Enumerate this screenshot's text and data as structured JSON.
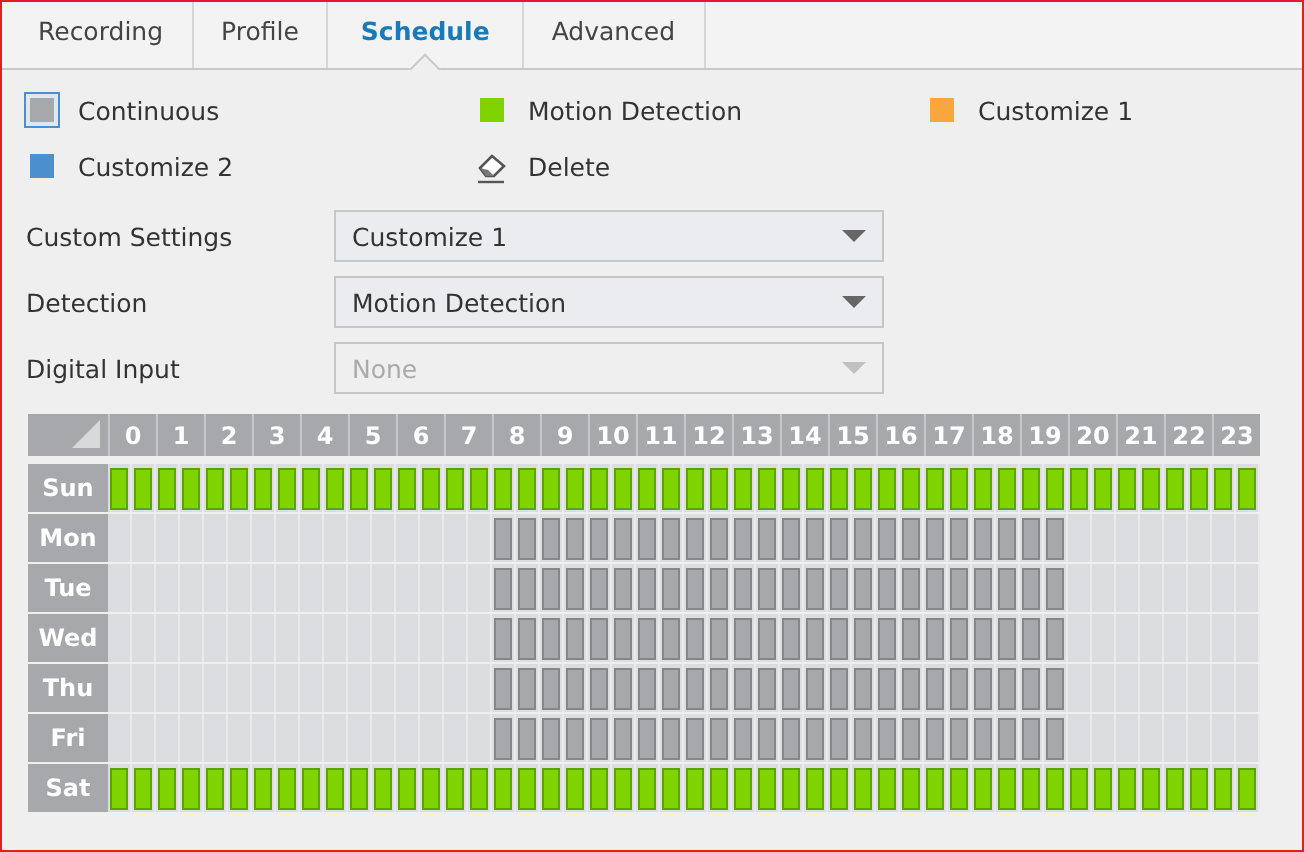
{
  "tabs": [
    {
      "label": "Recording",
      "selected": false
    },
    {
      "label": "Profile",
      "selected": false
    },
    {
      "label": "Schedule",
      "selected": true
    },
    {
      "label": "Advanced",
      "selected": false
    }
  ],
  "legend": [
    {
      "label": "Continuous",
      "kind": "swatch",
      "color": "#a6a8ab",
      "selected": true
    },
    {
      "label": "Motion Detection",
      "kind": "swatch",
      "color": "#7fd400",
      "selected": false
    },
    {
      "label": "Customize 1",
      "kind": "swatch",
      "color": "#f9a63c",
      "selected": false
    },
    {
      "label": "Customize 2",
      "kind": "swatch",
      "color": "#4d8fcc",
      "selected": false
    },
    {
      "label": "Delete",
      "kind": "eraser",
      "selected": false
    }
  ],
  "settings": [
    {
      "label": "Custom Settings",
      "value": "Customize 1",
      "disabled": false
    },
    {
      "label": "Detection",
      "value": "Motion Detection",
      "disabled": false
    },
    {
      "label": "Digital Input",
      "value": "None",
      "disabled": true
    }
  ],
  "schedule": {
    "hours": [
      "0",
      "1",
      "2",
      "3",
      "4",
      "5",
      "6",
      "7",
      "8",
      "9",
      "10",
      "11",
      "12",
      "13",
      "14",
      "15",
      "16",
      "17",
      "18",
      "19",
      "20",
      "21",
      "22",
      "23"
    ],
    "days": [
      {
        "label": "Sun",
        "slots": [
          {
            "kind": "motion"
          },
          {
            "kind": "motion"
          },
          {
            "kind": "motion"
          },
          {
            "kind": "motion"
          },
          {
            "kind": "motion"
          },
          {
            "kind": "motion"
          },
          {
            "kind": "motion"
          },
          {
            "kind": "motion"
          },
          {
            "kind": "motion"
          },
          {
            "kind": "motion"
          },
          {
            "kind": "motion"
          },
          {
            "kind": "motion"
          },
          {
            "kind": "motion"
          },
          {
            "kind": "motion"
          },
          {
            "kind": "motion"
          },
          {
            "kind": "motion"
          },
          {
            "kind": "motion"
          },
          {
            "kind": "motion"
          },
          {
            "kind": "motion"
          },
          {
            "kind": "motion"
          },
          {
            "kind": "motion"
          },
          {
            "kind": "motion"
          },
          {
            "kind": "motion"
          },
          {
            "kind": "motion"
          },
          {
            "kind": "motion"
          },
          {
            "kind": "motion"
          },
          {
            "kind": "motion"
          },
          {
            "kind": "motion"
          },
          {
            "kind": "motion"
          },
          {
            "kind": "motion"
          },
          {
            "kind": "motion"
          },
          {
            "kind": "motion"
          },
          {
            "kind": "motion"
          },
          {
            "kind": "motion"
          },
          {
            "kind": "motion"
          },
          {
            "kind": "motion"
          },
          {
            "kind": "motion"
          },
          {
            "kind": "motion"
          },
          {
            "kind": "motion"
          },
          {
            "kind": "motion"
          },
          {
            "kind": "motion"
          },
          {
            "kind": "motion"
          },
          {
            "kind": "motion"
          },
          {
            "kind": "motion"
          },
          {
            "kind": "motion"
          },
          {
            "kind": "motion"
          },
          {
            "kind": "motion"
          },
          {
            "kind": "motion"
          }
        ]
      },
      {
        "label": "Mon",
        "slots": [
          {
            "kind": "empty"
          },
          {
            "kind": "empty"
          },
          {
            "kind": "empty"
          },
          {
            "kind": "empty"
          },
          {
            "kind": "empty"
          },
          {
            "kind": "empty"
          },
          {
            "kind": "empty"
          },
          {
            "kind": "empty"
          },
          {
            "kind": "empty"
          },
          {
            "kind": "empty"
          },
          {
            "kind": "empty"
          },
          {
            "kind": "empty"
          },
          {
            "kind": "empty"
          },
          {
            "kind": "empty"
          },
          {
            "kind": "empty"
          },
          {
            "kind": "empty"
          },
          {
            "kind": "continuous"
          },
          {
            "kind": "continuous"
          },
          {
            "kind": "continuous"
          },
          {
            "kind": "continuous"
          },
          {
            "kind": "continuous"
          },
          {
            "kind": "continuous"
          },
          {
            "kind": "continuous"
          },
          {
            "kind": "continuous"
          },
          {
            "kind": "continuous"
          },
          {
            "kind": "continuous"
          },
          {
            "kind": "continuous"
          },
          {
            "kind": "continuous"
          },
          {
            "kind": "continuous"
          },
          {
            "kind": "continuous"
          },
          {
            "kind": "continuous"
          },
          {
            "kind": "continuous"
          },
          {
            "kind": "continuous"
          },
          {
            "kind": "continuous"
          },
          {
            "kind": "continuous"
          },
          {
            "kind": "continuous"
          },
          {
            "kind": "continuous"
          },
          {
            "kind": "continuous"
          },
          {
            "kind": "continuous"
          },
          {
            "kind": "continuous"
          },
          {
            "kind": "empty"
          },
          {
            "kind": "empty"
          },
          {
            "kind": "empty"
          },
          {
            "kind": "empty"
          },
          {
            "kind": "empty"
          },
          {
            "kind": "empty"
          },
          {
            "kind": "empty"
          },
          {
            "kind": "empty"
          }
        ]
      },
      {
        "label": "Tue",
        "slots": [
          {
            "kind": "empty"
          },
          {
            "kind": "empty"
          },
          {
            "kind": "empty"
          },
          {
            "kind": "empty"
          },
          {
            "kind": "empty"
          },
          {
            "kind": "empty"
          },
          {
            "kind": "empty"
          },
          {
            "kind": "empty"
          },
          {
            "kind": "empty"
          },
          {
            "kind": "empty"
          },
          {
            "kind": "empty"
          },
          {
            "kind": "empty"
          },
          {
            "kind": "empty"
          },
          {
            "kind": "empty"
          },
          {
            "kind": "empty"
          },
          {
            "kind": "empty"
          },
          {
            "kind": "continuous"
          },
          {
            "kind": "continuous"
          },
          {
            "kind": "continuous"
          },
          {
            "kind": "continuous"
          },
          {
            "kind": "continuous"
          },
          {
            "kind": "continuous"
          },
          {
            "kind": "continuous"
          },
          {
            "kind": "continuous"
          },
          {
            "kind": "continuous"
          },
          {
            "kind": "continuous"
          },
          {
            "kind": "continuous"
          },
          {
            "kind": "continuous"
          },
          {
            "kind": "continuous"
          },
          {
            "kind": "continuous"
          },
          {
            "kind": "continuous"
          },
          {
            "kind": "continuous"
          },
          {
            "kind": "continuous"
          },
          {
            "kind": "continuous"
          },
          {
            "kind": "continuous"
          },
          {
            "kind": "continuous"
          },
          {
            "kind": "continuous"
          },
          {
            "kind": "continuous"
          },
          {
            "kind": "continuous"
          },
          {
            "kind": "continuous"
          },
          {
            "kind": "empty"
          },
          {
            "kind": "empty"
          },
          {
            "kind": "empty"
          },
          {
            "kind": "empty"
          },
          {
            "kind": "empty"
          },
          {
            "kind": "empty"
          },
          {
            "kind": "empty"
          },
          {
            "kind": "empty"
          }
        ]
      },
      {
        "label": "Wed",
        "slots": [
          {
            "kind": "empty"
          },
          {
            "kind": "empty"
          },
          {
            "kind": "empty"
          },
          {
            "kind": "empty"
          },
          {
            "kind": "empty"
          },
          {
            "kind": "empty"
          },
          {
            "kind": "empty"
          },
          {
            "kind": "empty"
          },
          {
            "kind": "empty"
          },
          {
            "kind": "empty"
          },
          {
            "kind": "empty"
          },
          {
            "kind": "empty"
          },
          {
            "kind": "empty"
          },
          {
            "kind": "empty"
          },
          {
            "kind": "empty"
          },
          {
            "kind": "empty"
          },
          {
            "kind": "continuous"
          },
          {
            "kind": "continuous"
          },
          {
            "kind": "continuous"
          },
          {
            "kind": "continuous"
          },
          {
            "kind": "continuous"
          },
          {
            "kind": "continuous"
          },
          {
            "kind": "continuous"
          },
          {
            "kind": "continuous"
          },
          {
            "kind": "continuous"
          },
          {
            "kind": "continuous"
          },
          {
            "kind": "continuous"
          },
          {
            "kind": "continuous"
          },
          {
            "kind": "continuous"
          },
          {
            "kind": "continuous"
          },
          {
            "kind": "continuous"
          },
          {
            "kind": "continuous"
          },
          {
            "kind": "continuous"
          },
          {
            "kind": "continuous"
          },
          {
            "kind": "continuous"
          },
          {
            "kind": "continuous"
          },
          {
            "kind": "continuous"
          },
          {
            "kind": "continuous"
          },
          {
            "kind": "continuous"
          },
          {
            "kind": "continuous"
          },
          {
            "kind": "empty"
          },
          {
            "kind": "empty"
          },
          {
            "kind": "empty"
          },
          {
            "kind": "empty"
          },
          {
            "kind": "empty"
          },
          {
            "kind": "empty"
          },
          {
            "kind": "empty"
          },
          {
            "kind": "empty"
          }
        ]
      },
      {
        "label": "Thu",
        "slots": [
          {
            "kind": "empty"
          },
          {
            "kind": "empty"
          },
          {
            "kind": "empty"
          },
          {
            "kind": "empty"
          },
          {
            "kind": "empty"
          },
          {
            "kind": "empty"
          },
          {
            "kind": "empty"
          },
          {
            "kind": "empty"
          },
          {
            "kind": "empty"
          },
          {
            "kind": "empty"
          },
          {
            "kind": "empty"
          },
          {
            "kind": "empty"
          },
          {
            "kind": "empty"
          },
          {
            "kind": "empty"
          },
          {
            "kind": "empty"
          },
          {
            "kind": "empty"
          },
          {
            "kind": "continuous"
          },
          {
            "kind": "continuous"
          },
          {
            "kind": "continuous"
          },
          {
            "kind": "continuous"
          },
          {
            "kind": "continuous"
          },
          {
            "kind": "continuous"
          },
          {
            "kind": "continuous"
          },
          {
            "kind": "continuous"
          },
          {
            "kind": "continuous"
          },
          {
            "kind": "continuous"
          },
          {
            "kind": "continuous"
          },
          {
            "kind": "continuous"
          },
          {
            "kind": "continuous"
          },
          {
            "kind": "continuous"
          },
          {
            "kind": "continuous"
          },
          {
            "kind": "continuous"
          },
          {
            "kind": "continuous"
          },
          {
            "kind": "continuous"
          },
          {
            "kind": "continuous"
          },
          {
            "kind": "continuous"
          },
          {
            "kind": "continuous"
          },
          {
            "kind": "continuous"
          },
          {
            "kind": "continuous"
          },
          {
            "kind": "continuous"
          },
          {
            "kind": "empty"
          },
          {
            "kind": "empty"
          },
          {
            "kind": "empty"
          },
          {
            "kind": "empty"
          },
          {
            "kind": "empty"
          },
          {
            "kind": "empty"
          },
          {
            "kind": "empty"
          },
          {
            "kind": "empty"
          }
        ]
      },
      {
        "label": "Fri",
        "slots": [
          {
            "kind": "empty"
          },
          {
            "kind": "empty"
          },
          {
            "kind": "empty"
          },
          {
            "kind": "empty"
          },
          {
            "kind": "empty"
          },
          {
            "kind": "empty"
          },
          {
            "kind": "empty"
          },
          {
            "kind": "empty"
          },
          {
            "kind": "empty"
          },
          {
            "kind": "empty"
          },
          {
            "kind": "empty"
          },
          {
            "kind": "empty"
          },
          {
            "kind": "empty"
          },
          {
            "kind": "empty"
          },
          {
            "kind": "empty"
          },
          {
            "kind": "empty"
          },
          {
            "kind": "continuous"
          },
          {
            "kind": "continuous"
          },
          {
            "kind": "continuous"
          },
          {
            "kind": "continuous"
          },
          {
            "kind": "continuous"
          },
          {
            "kind": "continuous"
          },
          {
            "kind": "continuous"
          },
          {
            "kind": "continuous"
          },
          {
            "kind": "continuous"
          },
          {
            "kind": "continuous"
          },
          {
            "kind": "continuous"
          },
          {
            "kind": "continuous"
          },
          {
            "kind": "continuous"
          },
          {
            "kind": "continuous"
          },
          {
            "kind": "continuous"
          },
          {
            "kind": "continuous"
          },
          {
            "kind": "continuous"
          },
          {
            "kind": "continuous"
          },
          {
            "kind": "continuous"
          },
          {
            "kind": "continuous"
          },
          {
            "kind": "continuous"
          },
          {
            "kind": "continuous"
          },
          {
            "kind": "continuous"
          },
          {
            "kind": "continuous"
          },
          {
            "kind": "empty"
          },
          {
            "kind": "empty"
          },
          {
            "kind": "empty"
          },
          {
            "kind": "empty"
          },
          {
            "kind": "empty"
          },
          {
            "kind": "empty"
          },
          {
            "kind": "empty"
          },
          {
            "kind": "empty"
          }
        ]
      },
      {
        "label": "Sat",
        "slots": [
          {
            "kind": "motion"
          },
          {
            "kind": "motion"
          },
          {
            "kind": "motion"
          },
          {
            "kind": "motion"
          },
          {
            "kind": "motion"
          },
          {
            "kind": "motion"
          },
          {
            "kind": "motion"
          },
          {
            "kind": "motion"
          },
          {
            "kind": "motion"
          },
          {
            "kind": "motion"
          },
          {
            "kind": "motion"
          },
          {
            "kind": "motion"
          },
          {
            "kind": "motion"
          },
          {
            "kind": "motion"
          },
          {
            "kind": "motion"
          },
          {
            "kind": "motion"
          },
          {
            "kind": "motion"
          },
          {
            "kind": "motion"
          },
          {
            "kind": "motion"
          },
          {
            "kind": "motion"
          },
          {
            "kind": "motion"
          },
          {
            "kind": "motion"
          },
          {
            "kind": "motion"
          },
          {
            "kind": "motion"
          },
          {
            "kind": "motion"
          },
          {
            "kind": "motion"
          },
          {
            "kind": "motion"
          },
          {
            "kind": "motion"
          },
          {
            "kind": "motion"
          },
          {
            "kind": "motion"
          },
          {
            "kind": "motion"
          },
          {
            "kind": "motion"
          },
          {
            "kind": "motion"
          },
          {
            "kind": "motion"
          },
          {
            "kind": "motion"
          },
          {
            "kind": "motion"
          },
          {
            "kind": "motion"
          },
          {
            "kind": "motion"
          },
          {
            "kind": "motion"
          },
          {
            "kind": "motion"
          },
          {
            "kind": "motion"
          },
          {
            "kind": "motion"
          },
          {
            "kind": "motion"
          },
          {
            "kind": "motion"
          },
          {
            "kind": "motion"
          },
          {
            "kind": "motion"
          },
          {
            "kind": "motion"
          },
          {
            "kind": "motion"
          }
        ]
      }
    ]
  }
}
